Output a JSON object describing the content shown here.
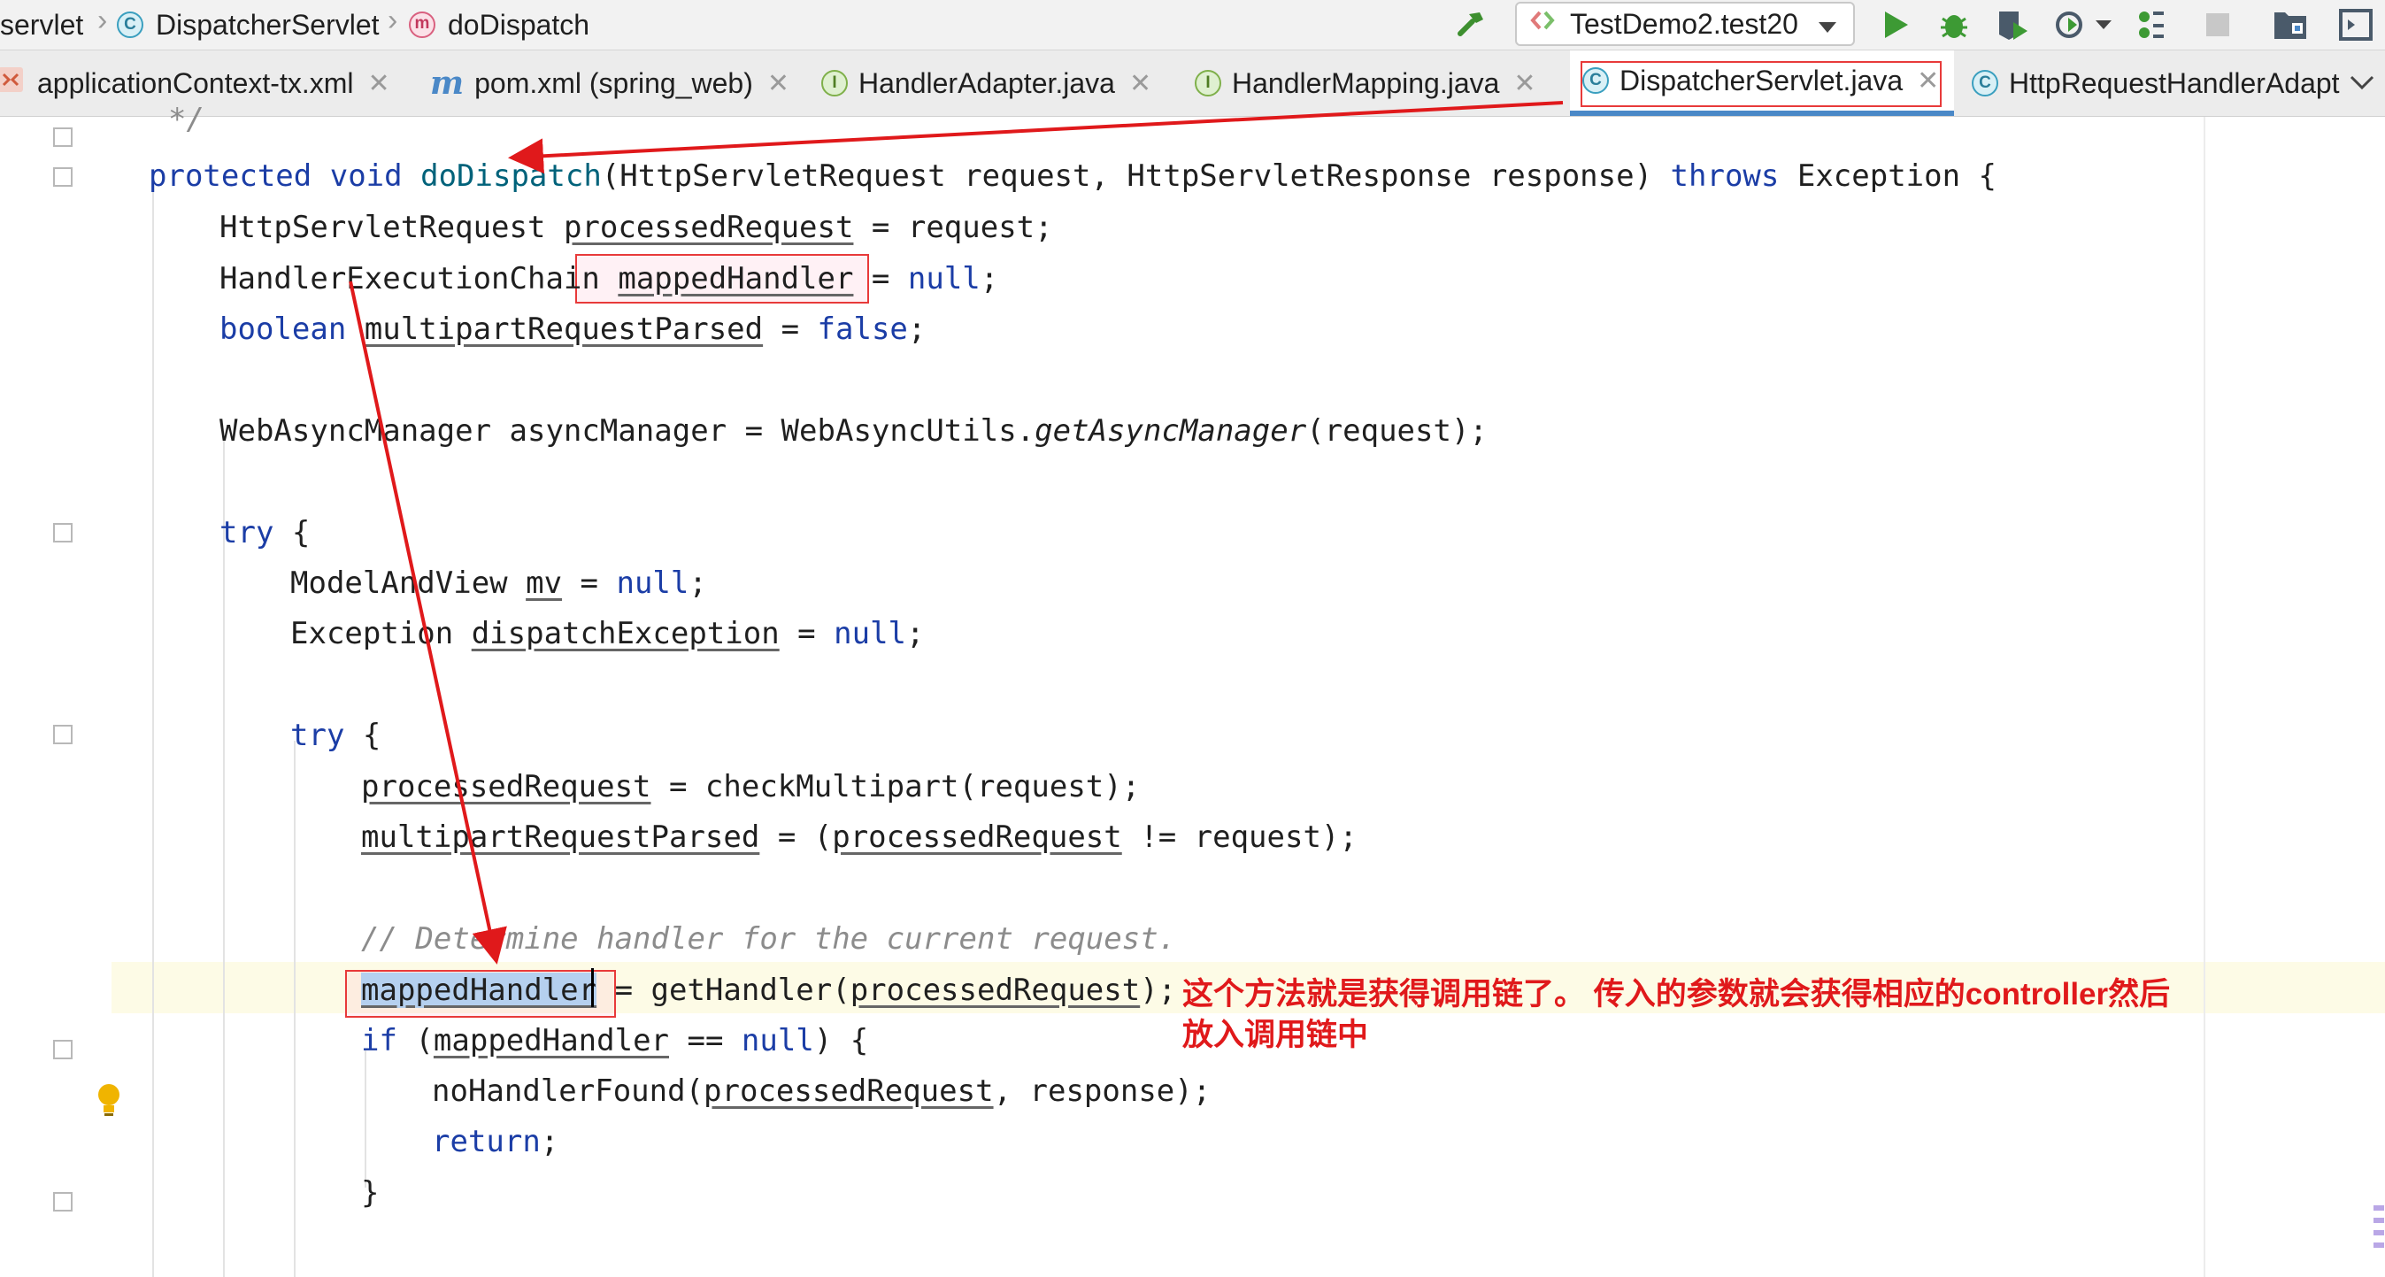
{
  "breadcrumb": {
    "items": [
      {
        "label": "servlet"
      },
      {
        "label": "DispatcherServlet",
        "icon": "class-icon"
      },
      {
        "label": "doDispatch",
        "icon": "method-icon"
      }
    ]
  },
  "toolbar": {
    "run_config": "TestDemo2.test20",
    "buttons": [
      "build-hammer-icon",
      "run-icon",
      "debug-icon",
      "coverage-icon",
      "profile-icon",
      "attach-icon",
      "stop-icon",
      "project-structure-icon",
      "terminal-icon"
    ]
  },
  "tabs": [
    {
      "label": "applicationContext-tx.xml",
      "icon": "xml-icon",
      "active": false
    },
    {
      "label": "pom.xml (spring_web)",
      "icon": "maven-icon",
      "active": false
    },
    {
      "label": "HandlerAdapter.java",
      "icon": "interface-icon",
      "active": false
    },
    {
      "label": "HandlerMapping.java",
      "icon": "interface-icon",
      "active": false
    },
    {
      "label": "DispatcherServlet.java",
      "icon": "class-icon",
      "active": true
    },
    {
      "label": "HttpRequestHandlerAdapt",
      "icon": "class-icon",
      "active": false
    }
  ],
  "code": {
    "l0": "*/",
    "l1_kw1": "protected",
    "l1_kw2": "void",
    "l1_fn": "doDispatch",
    "l1_rest": "(HttpServletRequest request, HttpServletResponse response)",
    "l1_kw3": "throws",
    "l1_end": "Exception {",
    "l2_type": "HttpServletRequest ",
    "l2_var": "processedRequest",
    "l2_rest": " = request;",
    "l3_type": "HandlerExecutionChain ",
    "l3_var": "mappedHandler",
    "l3_eq": " = ",
    "l3_kw": "null",
    "l3_end": ";",
    "l4_kw": "boolean",
    "l4_var": "multipartRequestParsed",
    "l4_eq": " = ",
    "l4_kw2": "false",
    "l4_end": ";",
    "l5_a": "WebAsyncManager asyncManager = WebAsyncUtils.",
    "l5_it": "getAsyncManager",
    "l5_b": "(request);",
    "l6_kw": "try",
    "l6_end": " {",
    "l7_type": "ModelAndView ",
    "l7_var": "mv",
    "l7_eq": " = ",
    "l7_kw": "null",
    "l7_end": ";",
    "l8_type": "Exception ",
    "l8_var": "dispatchException",
    "l8_eq": " = ",
    "l8_kw": "null",
    "l8_end": ";",
    "l9_kw": "try",
    "l9_end": " {",
    "l10_var": "processedRequest",
    "l10_rest": " = checkMultipart(request);",
    "l11_var": "multipartRequestParsed",
    "l11_a": " = (",
    "l11_var2": "processedRequest",
    "l11_b": " != request);",
    "l12_cm": "// Determine handler for the current request.",
    "l13_var": "mappedHandler",
    "l13_a": " = getHandler(",
    "l13_var2": "processedRequest",
    "l13_b": ");",
    "l14_kw": "if",
    "l14_a": " (",
    "l14_var": "mappedHandler",
    "l14_b": " == ",
    "l14_kw2": "null",
    "l14_c": ") {",
    "l15_a": "noHandlerFound(",
    "l15_var": "processedRequest",
    "l15_b": ", response);",
    "l16_kw": "return",
    "l16_end": ";",
    "l17": "}"
  },
  "annotation": {
    "line1": "这个方法就是获得调用链了。 传入的参数就会获得相应的controller然后",
    "line2": "放入调用链中"
  },
  "colors": {
    "keyword": "#1b3da6",
    "annotation": "#e0191b",
    "active_tab_underline": "#4a88c7",
    "current_line": "#fdfbe6"
  }
}
